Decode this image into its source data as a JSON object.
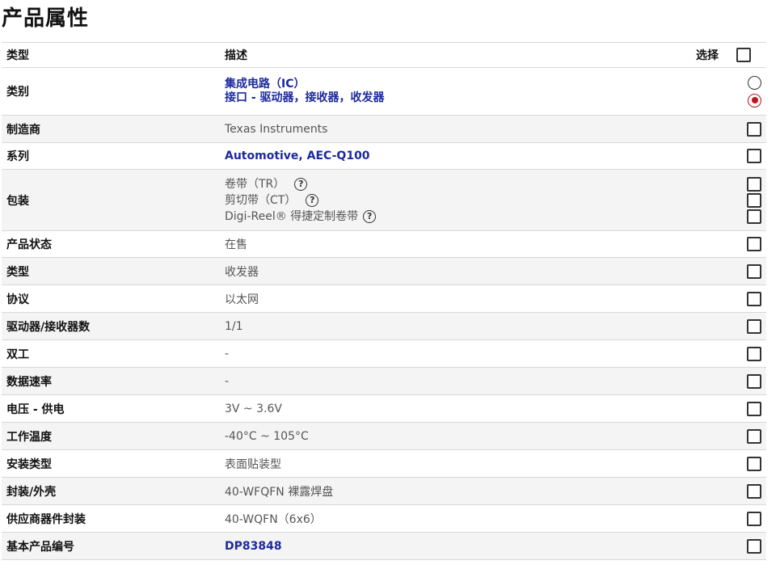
{
  "title": "产品属性",
  "headers": {
    "type": "类型",
    "desc": "描述",
    "select": "选择"
  },
  "rows": [
    {
      "key": "类别",
      "lines": [
        "集成电路（IC）",
        "接口 - 驱动器，接收器，收发器"
      ]
    },
    {
      "key": "制造商",
      "value": "Texas Instruments"
    },
    {
      "key": "系列",
      "value": "Automotive, AEC-Q100"
    },
    {
      "key": "包装",
      "lines": [
        "卷带（TR）",
        "剪切带（CT）",
        "Digi-Reel® 得捷定制卷带"
      ]
    },
    {
      "key": "产品状态",
      "value": "在售"
    },
    {
      "key": "类型",
      "value": "收发器"
    },
    {
      "key": "协议",
      "value": "以太网"
    },
    {
      "key": "驱动器/接收器数",
      "value": "1/1"
    },
    {
      "key": "双工",
      "value": "-"
    },
    {
      "key": "数据速率",
      "value": "-"
    },
    {
      "key": "电压 - 供电",
      "value": "3V ~ 3.6V"
    },
    {
      "key": "工作温度",
      "value": "-40°C ~ 105°C"
    },
    {
      "key": "安装类型",
      "value": "表面贴装型"
    },
    {
      "key": "封装/外壳",
      "value": "40-WFQFN 裸露焊盘"
    },
    {
      "key": "供应商器件封装",
      "value": "40-WQFN（6x6）"
    },
    {
      "key": "基本产品编号",
      "value": "DP83848"
    }
  ],
  "help_icon": "?",
  "icons": {
    "help": "question-circle-icon"
  },
  "colors": {
    "link": "#1c2a9e",
    "radio_selected": "#c0141c"
  }
}
